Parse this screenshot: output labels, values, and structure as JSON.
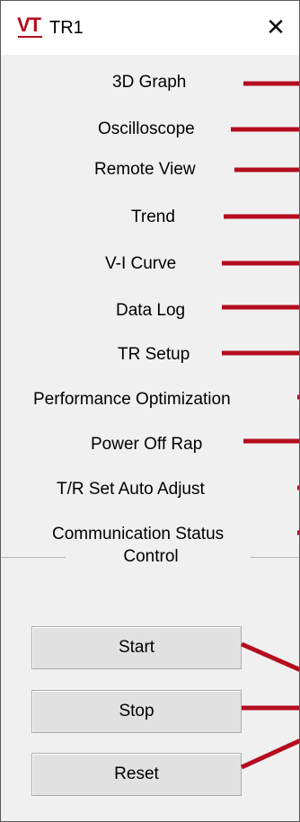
{
  "window": {
    "logo": "VT",
    "title": "TR1",
    "close_label": "✕"
  },
  "menu": {
    "items": [
      {
        "label": "3D Graph"
      },
      {
        "label": "Oscilloscope"
      },
      {
        "label": "Remote View"
      },
      {
        "label": "Trend"
      },
      {
        "label": "V-I Curve"
      },
      {
        "label": "Data Log"
      },
      {
        "label": "TR Setup"
      },
      {
        "label": "Performance Optimization"
      },
      {
        "label": "Power Off Rap"
      },
      {
        "label": "T/R Set Auto Adjust"
      },
      {
        "label": "Communication Status"
      }
    ]
  },
  "control": {
    "section_title": "Control",
    "start_label": "Start",
    "stop_label": "Stop",
    "reset_label": "Reset"
  },
  "colors": {
    "annotation": "#b40c1e",
    "window_bg": "#f0f0f0",
    "button_bg": "#e1e1e1"
  }
}
